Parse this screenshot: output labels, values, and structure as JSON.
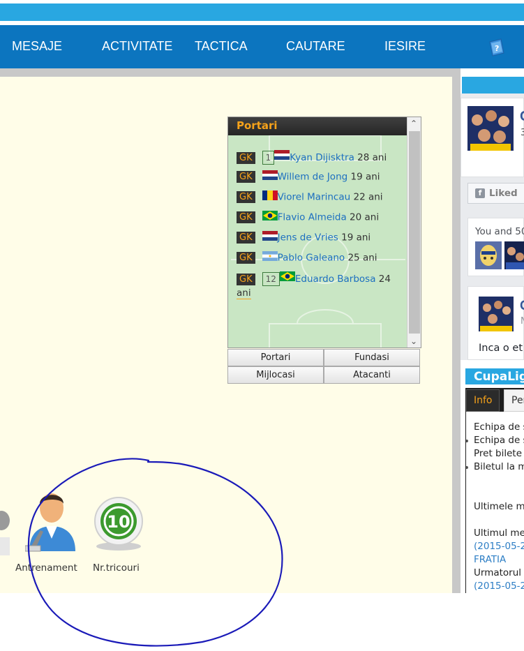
{
  "nav": {
    "items": [
      "MESAJE",
      "ACTIVITATE",
      "TACTICA",
      "CAUTARE",
      "IESIRE"
    ]
  },
  "goalkeepers": {
    "title": "Portari",
    "players": [
      {
        "pos": "GK",
        "number": "1",
        "flag": "netherlands",
        "name": "Kyan Dijisktra",
        "age": "28 ani"
      },
      {
        "pos": "GK",
        "number": "",
        "flag": "netherlands",
        "name": "Willem de Jong",
        "age": "19 ani"
      },
      {
        "pos": "GK",
        "number": "",
        "flag": "romania",
        "name": "Viorel Marincau",
        "age": "22 ani"
      },
      {
        "pos": "GK",
        "number": "",
        "flag": "brazil",
        "name": "Flavio Almeida",
        "age": "20 ani"
      },
      {
        "pos": "GK",
        "number": "",
        "flag": "netherlands",
        "name": "Jens de Vries",
        "age": "19 ani"
      },
      {
        "pos": "GK",
        "number": "",
        "flag": "argentina",
        "name": "Pablo Galeano",
        "age": "25 ani"
      },
      {
        "pos": "GK",
        "number": "12",
        "flag": "brazil",
        "name": "Eduardo Barbosa",
        "age": "24",
        "age_suffix": "ani"
      }
    ],
    "tabs": [
      "Portari",
      "Fundasi",
      "Mijlocasi",
      "Atacanti"
    ]
  },
  "tools": {
    "coach_label": "Antrenament",
    "jersey_label": "Nr.tricouri",
    "jersey_number": "10"
  },
  "facebook": {
    "page_name_partial": "C",
    "page_sub_partial": "3",
    "liked_label": "Liked",
    "friends_partial": "You and 50",
    "post_name_partial": "C",
    "post_sub_partial": "N",
    "post_text_partial": "Inca o et"
  },
  "cupa": {
    "title_partial": "CupaLigi",
    "tab_info": "Info",
    "tab_other_partial": "Per",
    "lines": [
      {
        "text": "Echipa de s",
        "bullet": false,
        "blue": false
      },
      {
        "text": "Echipa de s",
        "bullet": true,
        "blue": false
      },
      {
        "text": "Pret bilete",
        "bullet": false,
        "blue": false
      },
      {
        "text": "Biletul la m",
        "bullet": true,
        "blue": false
      },
      {
        "text": "Ultimele m",
        "bullet": false,
        "blue": false
      },
      {
        "text": "Ultimul me",
        "bullet": false,
        "blue": false
      },
      {
        "text": "(2015-05-2",
        "bullet": false,
        "blue": true
      },
      {
        "text": "FRATIA",
        "bullet": false,
        "blue": true
      },
      {
        "text": "Urmatorul",
        "bullet": false,
        "blue": false
      },
      {
        "text": "(2015-05-2",
        "bullet": false,
        "blue": true
      }
    ]
  },
  "colors": {
    "nav_bg": "#0c75bf",
    "top_strip": "#29a7e1",
    "content_bg": "#fffde8",
    "gk_accent": "#f6a21a",
    "link": "#1c6fc0",
    "annotation_circle": "#1a1ab8"
  }
}
